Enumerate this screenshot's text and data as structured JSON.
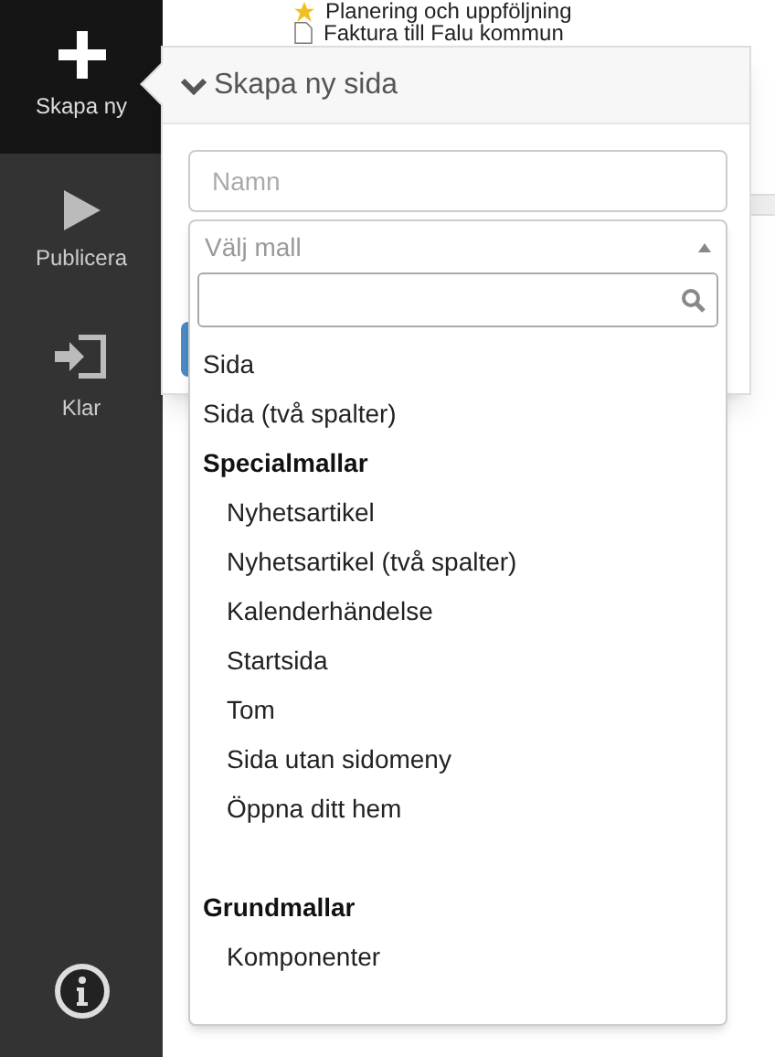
{
  "sidebar": {
    "items": [
      {
        "label": "Skapa ny",
        "kind": "create",
        "selected": true
      },
      {
        "label": "Publicera",
        "kind": "publish",
        "selected": false
      },
      {
        "label": "Klar",
        "kind": "done",
        "selected": false
      }
    ]
  },
  "tree": [
    {
      "label": "Planering och uppföljning",
      "kind": "starred"
    },
    {
      "label": "Faktura till Falu kommun",
      "kind": "page"
    }
  ],
  "popover": {
    "title": "Skapa ny sida",
    "name_field": {
      "placeholder": "Namn"
    },
    "template_select": {
      "placeholder": "Välj mall",
      "expanded": true,
      "options": [
        {
          "kind": "option",
          "label": "Sida"
        },
        {
          "kind": "option",
          "label": "Sida (två spalter)"
        },
        {
          "kind": "group",
          "label": "Specialmallar",
          "children": [
            {
              "label": "Nyhetsartikel"
            },
            {
              "label": "Nyhetsartikel (två spalter)"
            },
            {
              "label": "Kalenderhändelse"
            },
            {
              "label": "Startsida"
            },
            {
              "label": "Tom"
            },
            {
              "label": "Sida utan sidomeny"
            },
            {
              "label": "Öppna ditt hem"
            }
          ]
        },
        {
          "kind": "group",
          "label": "Grundmallar",
          "children": [
            {
              "label": "Komponenter"
            }
          ]
        }
      ]
    }
  }
}
